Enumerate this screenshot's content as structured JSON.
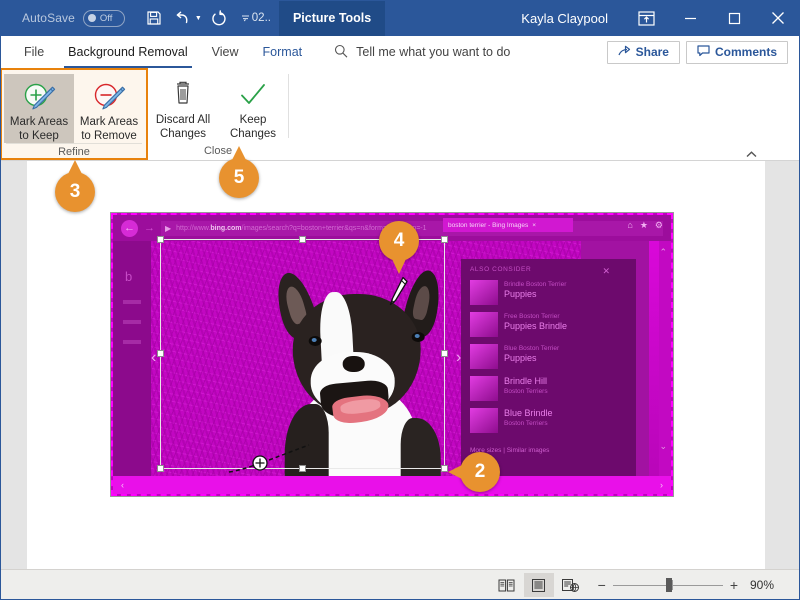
{
  "titlebar": {
    "autosave_label": "AutoSave",
    "autosave_state": "Off",
    "save_icon": "save-icon",
    "undo_icon": "undo-icon",
    "redo_icon": "redo-icon",
    "qat_more": "02..",
    "contextual_tab": "Picture Tools",
    "user_name": "Kayla Claypool",
    "ribbon_display_icon": "ribbon-display-options-icon",
    "minimize": "—",
    "maximize": "□",
    "close": "✕"
  },
  "tabs": [
    {
      "label": "File",
      "active": false,
      "accent": false
    },
    {
      "label": "Background Removal",
      "active": true,
      "accent": false
    },
    {
      "label": "View",
      "active": false,
      "accent": false
    },
    {
      "label": "Format",
      "active": false,
      "accent": true
    }
  ],
  "tellme": {
    "icon": "search-icon",
    "placeholder": "Tell me what you want to do"
  },
  "header_buttons": [
    {
      "label": "Share",
      "icon": "share-icon"
    },
    {
      "label": "Comments",
      "icon": "comments-icon"
    }
  ],
  "ribbon": {
    "groups": [
      {
        "name": "Refine",
        "title": "Refine",
        "highlighted": true,
        "buttons": [
          {
            "label_line1": "Mark Areas",
            "label_line2": "to Keep",
            "icon": "mark-keep-icon",
            "selected": true
          },
          {
            "label_line1": "Mark Areas",
            "label_line2": "to Remove",
            "icon": "mark-remove-icon",
            "selected": false
          }
        ]
      },
      {
        "name": "Close",
        "title": "Close",
        "highlighted": false,
        "buttons": [
          {
            "label_line1": "Discard All",
            "label_line2": "Changes",
            "icon": "trash-icon",
            "selected": false
          },
          {
            "label_line1": "Keep",
            "label_line2": "Changes",
            "icon": "checkmark-icon",
            "selected": false
          }
        ]
      }
    ],
    "collapse_icon": "chevron-up-icon"
  },
  "callouts": [
    {
      "number": "2",
      "direction": "left"
    },
    {
      "number": "3",
      "direction": "up"
    },
    {
      "number": "4",
      "direction": "down"
    },
    {
      "number": "5",
      "direction": "up"
    }
  ],
  "picture": {
    "description": "Bing image search screenshot of a Boston Terrier, magenta background-removal overlay",
    "browser": {
      "back_icon": "back-arrow-icon",
      "forward_icon": "forward-arrow-icon",
      "url_prefix": "http://www.",
      "url_domain": "bing.com",
      "url_rest": "/images/search?q=boston+terrier&qs=n&form=QBIR&sp=-1",
      "tab_title": "boston terrier - Bing Images",
      "tab_close": "×",
      "top_icons": [
        "home-icon",
        "favorites-icon",
        "settings-icon"
      ]
    },
    "panel": {
      "title": "ALSO CONSIDER",
      "close_icon": "close-icon",
      "suggestions": [
        {
          "line1": "Brindle Boston Terrier",
          "line2": "Puppies"
        },
        {
          "line1": "Free Boston Terrier",
          "line2": "Puppies Brindle"
        },
        {
          "line1": "Blue Boston Terrier",
          "line2": "Puppies"
        },
        {
          "line1": "Brindle Hill",
          "line2": "Boston Terriers",
          "swap": true
        },
        {
          "line1": "Blue Brindle",
          "line2": "Boston Terriers",
          "swap": true
        }
      ],
      "footer_links": "More sizes | Similar images",
      "scroll_up_icon": "chevron-up-icon",
      "scroll_down_icon": "chevron-down-icon"
    },
    "bottom_prev": "‹",
    "bottom_next": "›",
    "mark_keep_stroke": "mark-keep-stroke",
    "pencil_cursor": "pencil-cursor-icon"
  },
  "statusbar": {
    "view_buttons": [
      {
        "icon": "read-mode-icon",
        "selected": false
      },
      {
        "icon": "print-layout-icon",
        "selected": true
      },
      {
        "icon": "web-layout-icon",
        "selected": false
      }
    ],
    "zoom_out": "−",
    "zoom_in": "+",
    "zoom_level": "90%"
  },
  "colors": {
    "title_bar": "#2b579a",
    "accent_orange": "#e8922f",
    "magenta": "#c400c4",
    "link_blue": "#2b579a"
  }
}
